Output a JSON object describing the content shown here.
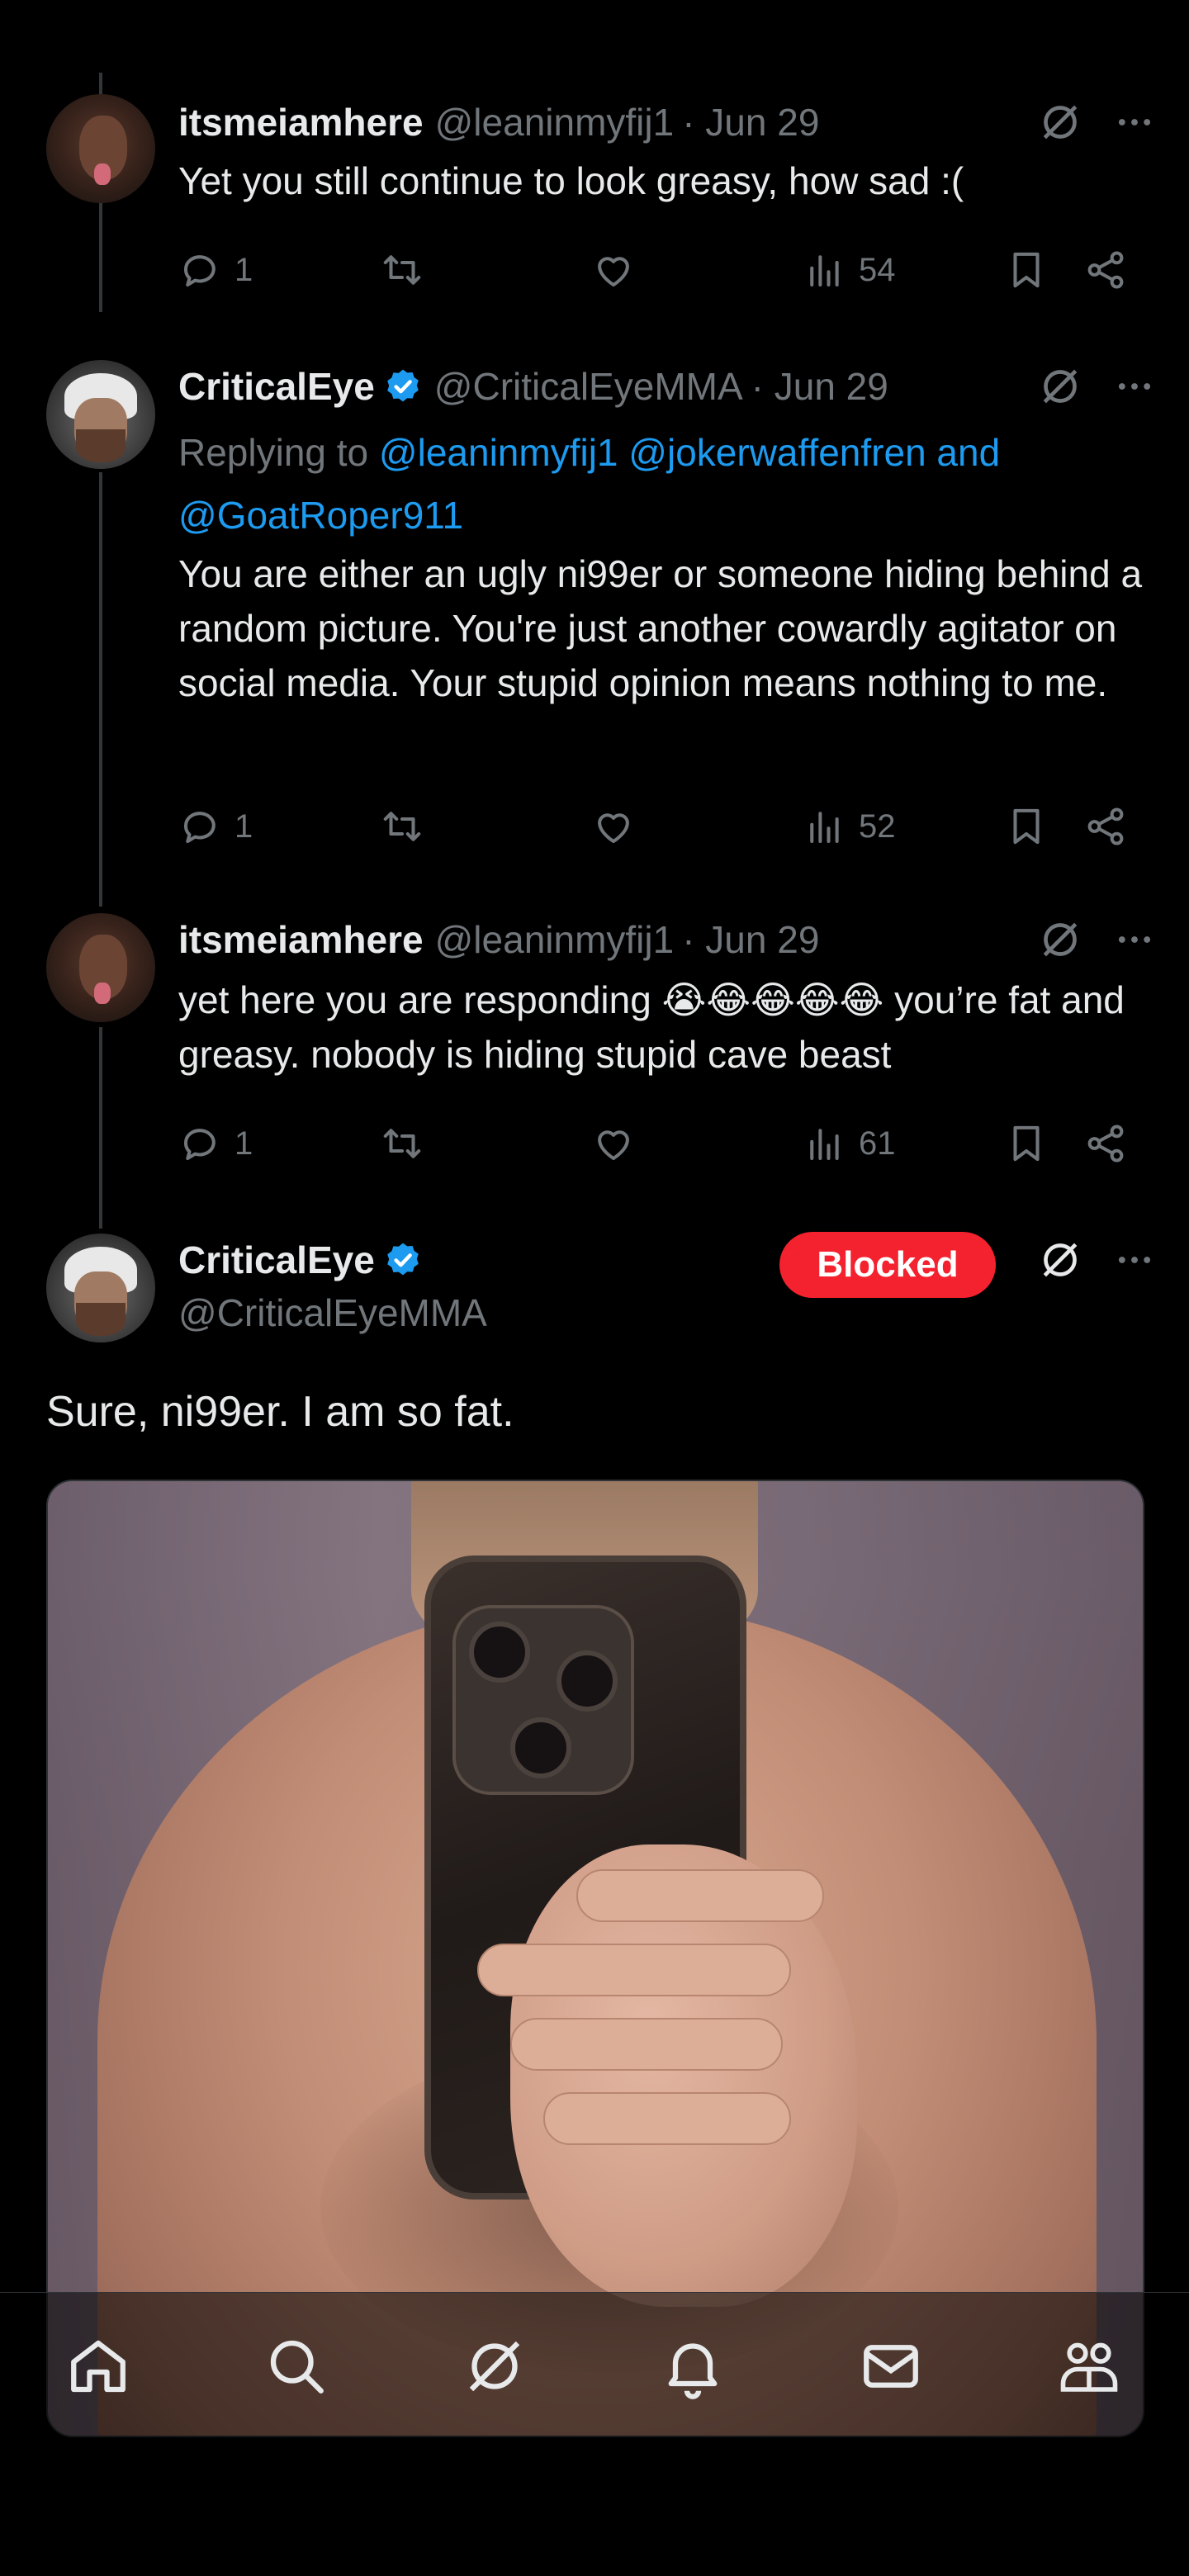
{
  "tweets": [
    {
      "name": "itsmeiamhere",
      "handle": "@leaninmyfij1",
      "date": "· Jun 29",
      "text": "Yet you still continue to look greasy, how sad :(",
      "replies": "1",
      "views": "54"
    },
    {
      "name": "CriticalEye",
      "handle": "@CriticalEyeMMA",
      "date": "· Jun 29",
      "replying_prefix": "Replying to ",
      "replying_users": "@leaninmyfij1 @jokerwaffenfren and @GoatRoper911",
      "text": "You are either an ugly ni99er or someone hiding behind a random picture. You're just another cowardly agitator on social media. Your stupid opinion means nothing to me.",
      "replies": "1",
      "views": "52"
    },
    {
      "name": "itsmeiamhere",
      "handle": "@leaninmyfij1",
      "date": "· Jun 29",
      "text": "yet here you are responding 😭😂😂😂😂 you’re fat and greasy. nobody is hiding stupid cave beast",
      "replies": "1",
      "views": "61"
    }
  ],
  "focus_tweet": {
    "name": "CriticalEye",
    "handle": "@CriticalEyeMMA",
    "blocked_label": "Blocked",
    "text": "Sure, ni99er. I am so fat."
  },
  "icons": {
    "verified": "verified-badge-icon",
    "grok": "grok-icon",
    "more": "more-icon",
    "reply": "reply-icon",
    "retweet": "retweet-icon",
    "like": "like-icon",
    "views": "views-icon",
    "bookmark": "bookmark-icon",
    "share": "share-icon"
  },
  "bottom_nav": [
    "home-icon",
    "search-icon",
    "grok-icon",
    "notifications-icon",
    "messages-icon",
    "communities-icon"
  ],
  "colors": {
    "background": "#000000",
    "text": "#e7e9ea",
    "secondary": "#71767b",
    "link": "#1d9bf0",
    "blocked": "#f4212e"
  }
}
